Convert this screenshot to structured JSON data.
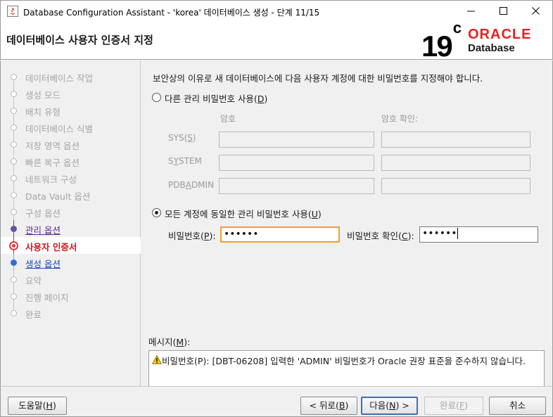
{
  "window": {
    "title": "Database Configuration Assistant - 'korea' 데이터베이스 생성 - 단계 11/15",
    "minimize_icon": "minimize-icon",
    "maximize_icon": "maximize-icon",
    "close_icon": "close-icon"
  },
  "header": {
    "step_title": "데이터베이스 사용자 인증서 지정",
    "logo": {
      "version": "19",
      "version_sup": "c",
      "brand": "ORACLE",
      "product": "Database"
    }
  },
  "sidebar": {
    "steps": [
      {
        "label": "데이터베이스 작업",
        "state": "disabled"
      },
      {
        "label": "생성 모드",
        "state": "disabled"
      },
      {
        "label": "배치 유형",
        "state": "disabled"
      },
      {
        "label": "데이터베이스 식별",
        "state": "disabled"
      },
      {
        "label": "저장 영역 옵션",
        "state": "disabled"
      },
      {
        "label": "빠른 복구 옵션",
        "state": "disabled"
      },
      {
        "label": "네트워크 구성",
        "state": "disabled"
      },
      {
        "label": "Data Vault 옵션",
        "state": "disabled"
      },
      {
        "label": "구성 옵션",
        "state": "disabled"
      },
      {
        "label": "관리 옵션",
        "state": "done"
      },
      {
        "label": "사용자 인증서",
        "state": "current"
      },
      {
        "label": "생성 옵션",
        "state": "next"
      },
      {
        "label": "요약",
        "state": "disabled"
      },
      {
        "label": "진행 페이지",
        "state": "disabled"
      },
      {
        "label": "완료",
        "state": "disabled"
      }
    ]
  },
  "main": {
    "instruction": "보안상의 이유로 새 데이터베이스에 다음 사용자 계정에 대한 비밀번호를 지정해야 합니다.",
    "option_separate": {
      "label": "다른 관리 비밀번호 사용(_D)",
      "selected": false
    },
    "col_password": "암호",
    "col_confirm": "암호 확인:",
    "accounts": [
      {
        "label": "SYS(_S)"
      },
      {
        "label": "S_YSTEM"
      },
      {
        "label": "PDB_ADMIN"
      }
    ],
    "option_same": {
      "label": "모든 계정에 동일한 관리 비밀번호 사용(_U)",
      "selected": true
    },
    "password_label": "비밀번호(_P):",
    "password_value": "••••••",
    "confirm_label": "비밀번호 확인(_C):",
    "confirm_value": "••••••",
    "messages_label": "메시지(_M):",
    "message": "비밀번호(P): [DBT-06208] 입력한 'ADMIN' 비밀번호가 Oracle 권장 표준을 준수하지 않습니다.",
    "message_icon": "warning-icon"
  },
  "buttons": {
    "help": "도움말(_H)",
    "back": "< 뒤로(_B)",
    "next": "다음(_N) >",
    "finish": "완료(_F)",
    "cancel": "취소"
  }
}
